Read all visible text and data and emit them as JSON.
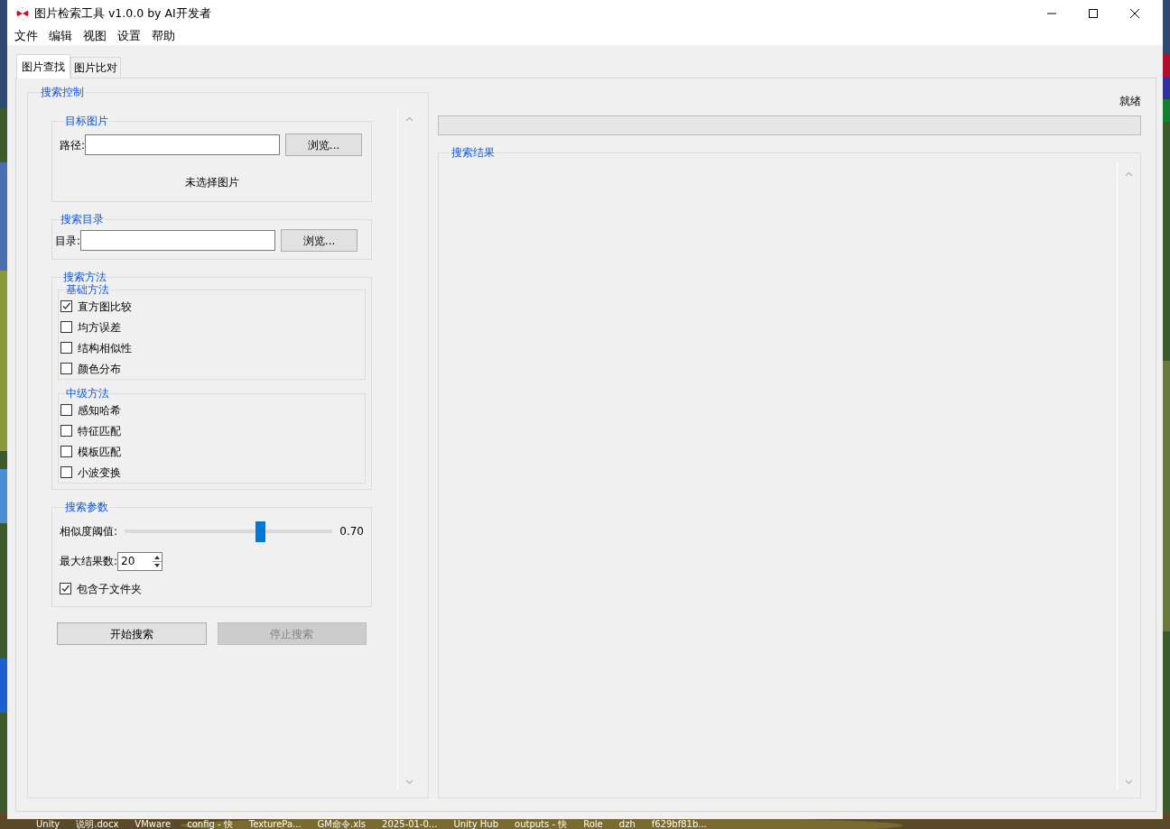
{
  "window": {
    "title": "图片检索工具 v1.0.0 by AI开发者"
  },
  "menu": [
    "文件",
    "编辑",
    "视图",
    "设置",
    "帮助"
  ],
  "tabs": [
    {
      "label": "图片查找",
      "selected": true
    },
    {
      "label": "图片比对",
      "selected": false
    }
  ],
  "search_control": {
    "title": "搜索控制",
    "target_image": {
      "title": "目标图片",
      "path_label": "路径:",
      "browse": "浏览...",
      "status": "未选择图片"
    },
    "search_dir": {
      "title": "搜索目录",
      "dir_label": "目录:",
      "browse": "浏览..."
    },
    "methods": {
      "title": "搜索方法",
      "groups": [
        {
          "title": "基础方法",
          "options": [
            {
              "label": "直方图比较",
              "checked": true
            },
            {
              "label": "均方误差",
              "checked": false
            },
            {
              "label": "结构相似性",
              "checked": false
            },
            {
              "label": "颜色分布",
              "checked": false
            }
          ]
        },
        {
          "title": "中级方法",
          "options": [
            {
              "label": "感知哈希",
              "checked": false
            },
            {
              "label": "特征匹配",
              "checked": false
            },
            {
              "label": "模板匹配",
              "checked": false
            },
            {
              "label": "小波变换",
              "checked": false
            }
          ]
        }
      ]
    },
    "params": {
      "title": "搜索参数",
      "threshold_label": "相似度阈值:",
      "threshold": {
        "level": 0.65
      },
      "threshold_reading": "0.70",
      "max_results_label": "最大结果数:",
      "max_results": "20",
      "include_subfolders": {
        "label": "包含子文件夹",
        "checked": true
      }
    },
    "buttons": [
      {
        "label": "开始搜索",
        "disabled": false
      },
      {
        "label": "停止搜索",
        "disabled": true
      }
    ]
  },
  "status": "就绪",
  "progress": {
    "level": 0
  },
  "results": {
    "title": "搜索结果"
  },
  "desktop_labels": [
    "Unity",
    "说明.docx",
    "VMware",
    "config - 快",
    "TexturePa...",
    "GM命令.xls",
    "2025-01-0...",
    "Unity Hub",
    "outputs - 快",
    "Role",
    "dzh",
    "f629bf81b..."
  ]
}
